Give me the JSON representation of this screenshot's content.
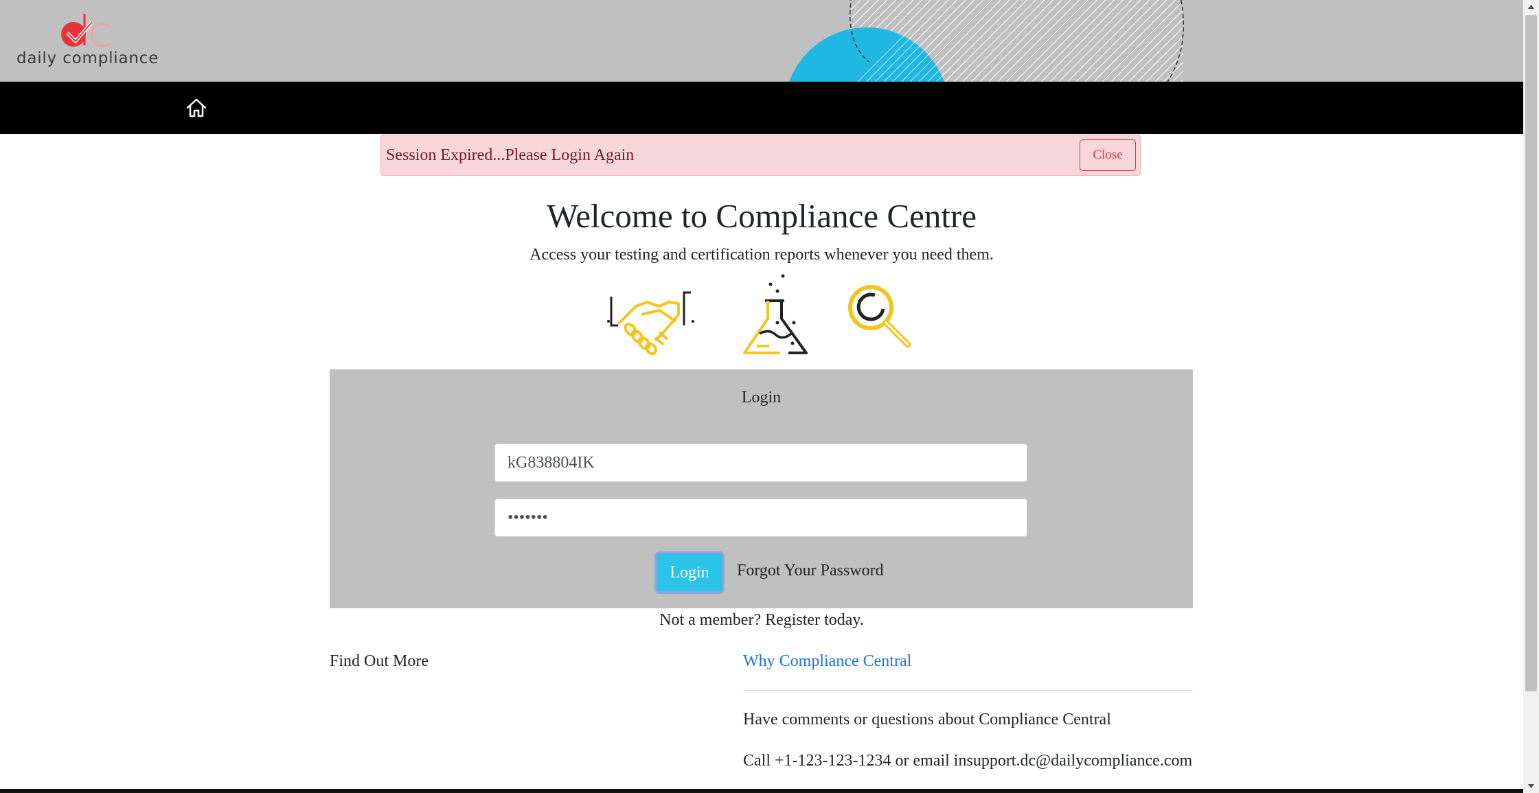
{
  "header": {
    "logo_text": "daily compliance",
    "logo_letters": "dc",
    "brand_color": "#e8323c",
    "nav_home_icon": "home-icon"
  },
  "alert": {
    "message": "Session Expired...Please Login Again",
    "close_label": "Close"
  },
  "welcome": {
    "title": "Welcome to Compliance Centre",
    "subtitle": "Access your testing and certification reports whenever you need them.",
    "icons": [
      "handshake-icon",
      "flask-icon",
      "magnifier-icon"
    ],
    "icon_color": "#f5c51b"
  },
  "login": {
    "title": "Login",
    "username_value": "kG838804IK",
    "password_value": "•••••••",
    "login_label": "Login",
    "forgot_label": "Forgot Your Password",
    "button_color": "#2bc3e8"
  },
  "footer": {
    "register_text": "Not a member? Register today.",
    "find_out_more": "Find Out More",
    "why_link": "Why Compliance Central",
    "comments_text": "Have comments or questions about Compliance Central",
    "contact_text": "Call +1-123-123-1234 or email insupport.dc@dailycompliance.com"
  }
}
